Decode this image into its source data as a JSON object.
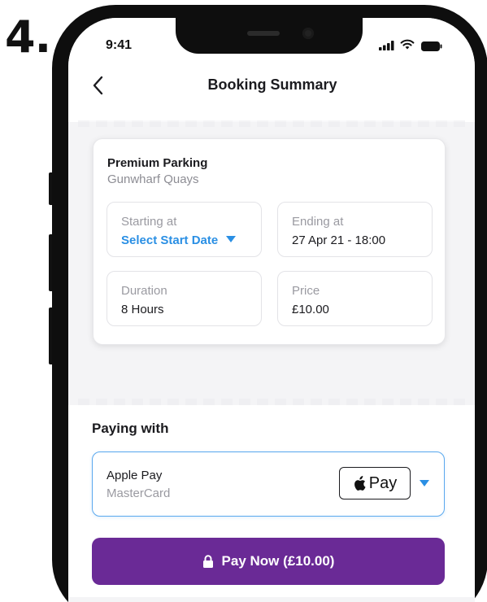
{
  "step_number": "4.",
  "status_bar": {
    "time": "9:41"
  },
  "header": {
    "title": "Booking Summary",
    "back_icon": "chevron-left-icon"
  },
  "booking": {
    "title": "Premium Parking",
    "location": "Gunwharf Quays",
    "starting": {
      "label": "Starting at",
      "value": "Select Start Date"
    },
    "ending": {
      "label": "Ending at",
      "value": "27 Apr 21 - 18:00"
    },
    "duration": {
      "label": "Duration",
      "value": "8 Hours"
    },
    "price": {
      "label": "Price",
      "value": "£10.00"
    }
  },
  "payment": {
    "heading": "Paying with",
    "method": "Apple Pay",
    "card": "MasterCard",
    "badge_text": "Pay"
  },
  "pay_button": {
    "label": "Pay Now (£10.00)"
  },
  "colors": {
    "accent_blue": "#2a8fe4",
    "primary_purple": "#6a2a96"
  }
}
